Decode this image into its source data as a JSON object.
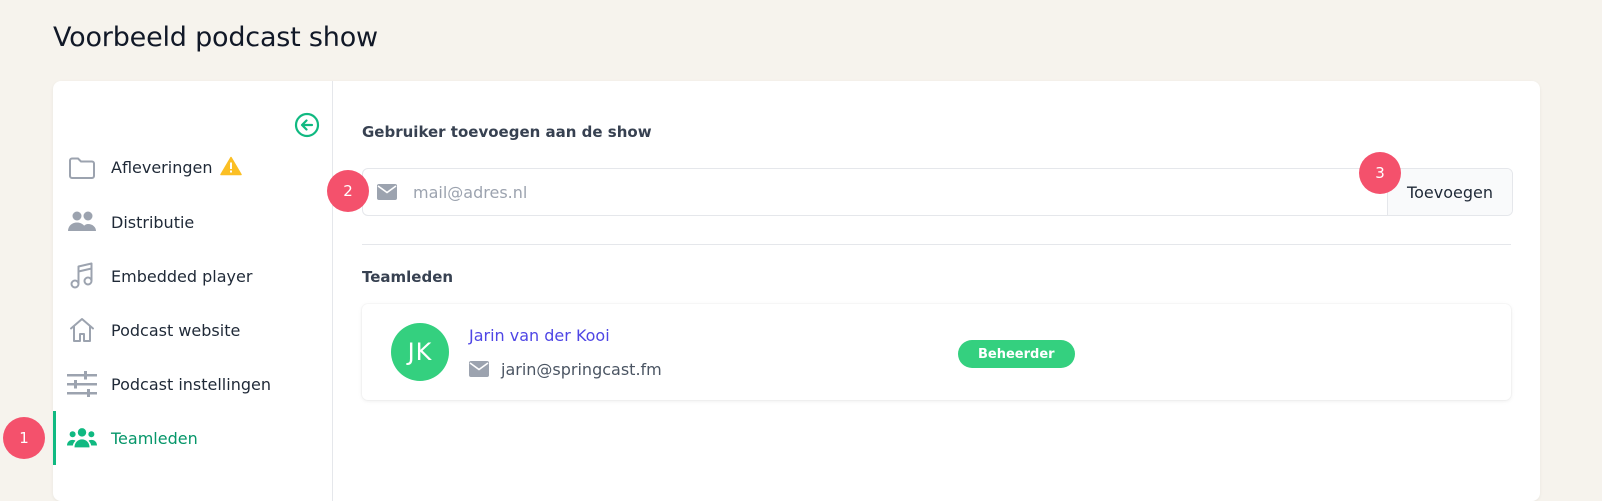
{
  "page": {
    "title": "Voorbeeld podcast show"
  },
  "sidebar": {
    "items": [
      {
        "label": "Afleveringen",
        "icon": "folder-icon",
        "warning": true
      },
      {
        "label": "Distributie",
        "icon": "users-icon"
      },
      {
        "label": "Embedded player",
        "icon": "music-note-icon"
      },
      {
        "label": "Podcast website",
        "icon": "home-icon"
      },
      {
        "label": "Podcast instellingen",
        "icon": "sliders-icon"
      },
      {
        "label": "Teamleden",
        "icon": "team-icon",
        "active": true
      }
    ]
  },
  "main": {
    "add_user": {
      "title": "Gebruiker toevoegen aan de show",
      "placeholder": "mail@adres.nl",
      "button": "Toevoegen"
    },
    "team": {
      "title": "Teamleden",
      "members": [
        {
          "initials": "JK",
          "name": "Jarin van der Kooi",
          "email": "jarin@springcast.fm",
          "role": "Beheerder"
        }
      ]
    }
  },
  "steps": [
    "1",
    "2",
    "3"
  ],
  "colors": {
    "accent": "#10b981",
    "avatar": "#34d07f",
    "link": "#4f46e5",
    "step": "#f4516c",
    "warning": "#fbbf24"
  }
}
